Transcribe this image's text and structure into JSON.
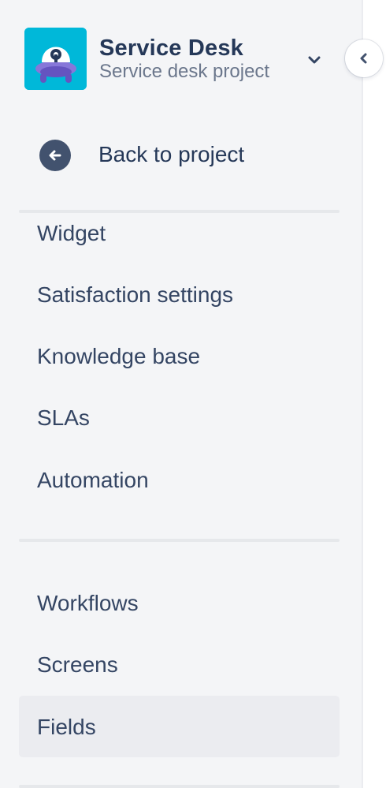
{
  "project": {
    "name": "Service Desk",
    "type": "Service desk project",
    "avatar_color": "#00b8d9",
    "avatar_icon": "service-desk-ufo-icon"
  },
  "header": {
    "switcher_icon": "chevron-down-icon",
    "collapse_icon": "chevron-left-icon"
  },
  "back": {
    "label": "Back to project",
    "icon": "arrow-left-circle-icon"
  },
  "nav_group_1": [
    {
      "label": "Widget"
    },
    {
      "label": "Satisfaction settings"
    },
    {
      "label": "Knowledge base"
    },
    {
      "label": "SLAs"
    },
    {
      "label": "Automation"
    }
  ],
  "nav_group_2": [
    {
      "label": "Workflows"
    },
    {
      "label": "Screens"
    },
    {
      "label": "Fields",
      "selected": true
    }
  ],
  "colors": {
    "sidebar_bg": "#f4f5f7",
    "text": "#253858",
    "subtle_text": "#6b778c",
    "selected_bg": "#ebecf0"
  }
}
